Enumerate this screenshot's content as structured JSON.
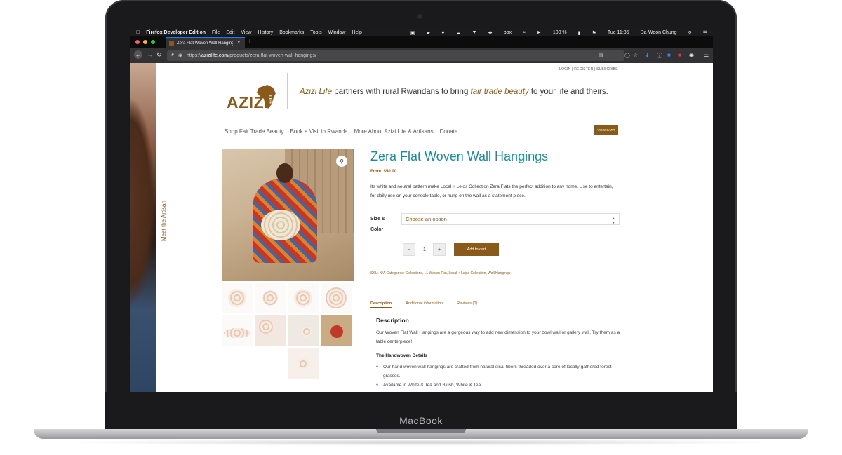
{
  "device": {
    "brand": "MacBook"
  },
  "menubar": {
    "app": "Firefox Developer Edition",
    "items": [
      "File",
      "Edit",
      "View",
      "History",
      "Bookmarks",
      "Tools",
      "Window",
      "Help"
    ],
    "battery": "100 %",
    "clock": "Tue 11:35",
    "user": "Da-Woon Chung",
    "box": "box"
  },
  "tab": {
    "title": "Zera Flat Woven Wall Hangings"
  },
  "url": {
    "prefix": "https://",
    "domain": "azizilife.com",
    "path": "/products/zera-flat-woven-wall-hangings/"
  },
  "site": {
    "toplinks": "LOGIN  |  REGISTER  |  SUBSCRIBE",
    "logo": "AZIZI",
    "logo_life": "LIFE",
    "tagline": {
      "part1": "Azizi Life",
      "part2": " partners with rural Rwandans to bring ",
      "part3": "fair trade beauty",
      "part4": " to your life and theirs."
    },
    "nav": [
      "Shop Fair Trade Beauty",
      "Book a Visit in Rwanda",
      "More About Azizi Life & Artisans",
      "Donate"
    ],
    "view_cart": "VIEW CART",
    "side_banner": "Meet the Artisan"
  },
  "product": {
    "title": "Zera Flat Woven Wall Hangings",
    "price": "From: $50.00",
    "description": "Its white and neutral pattern make Local + Lejos Collection Zera Flats the perfect addition to any home. Use to entertain, for daily use on your console table, or hung on the wall as a statement piece.",
    "size_label": "Size & Color",
    "select_placeholder": "Choose an option",
    "qty_minus": "-",
    "qty_value": "1",
    "qty_plus": "+",
    "add_to_cart": "Add to cart",
    "meta_sku": "SKU: N/A",
    "meta_categories": " Categories: Collections, LL Woven Flat, Local + Lejos Collection, Wall Hangings"
  },
  "tabs": [
    "Description",
    "Additional information",
    "Reviews (0)"
  ],
  "description": {
    "heading": "Description",
    "paragraph": "Our Woven Flat Wall Hangings are a gorgeous way to add new dimension to your bowl wall or gallery wall.  Try them as a table centerpiece!",
    "subheading": "The Handwoven Details",
    "bullets": [
      "Our hand woven wall hangings are crafted from natural sisal fibers threaded over a core of locally-gathered forest grasses.",
      "Available in White & Tea and Blush, White & Tea."
    ]
  },
  "colors": {
    "accent": "#8a5a1b",
    "title": "#1a8b9d",
    "chrome": "#323234"
  }
}
